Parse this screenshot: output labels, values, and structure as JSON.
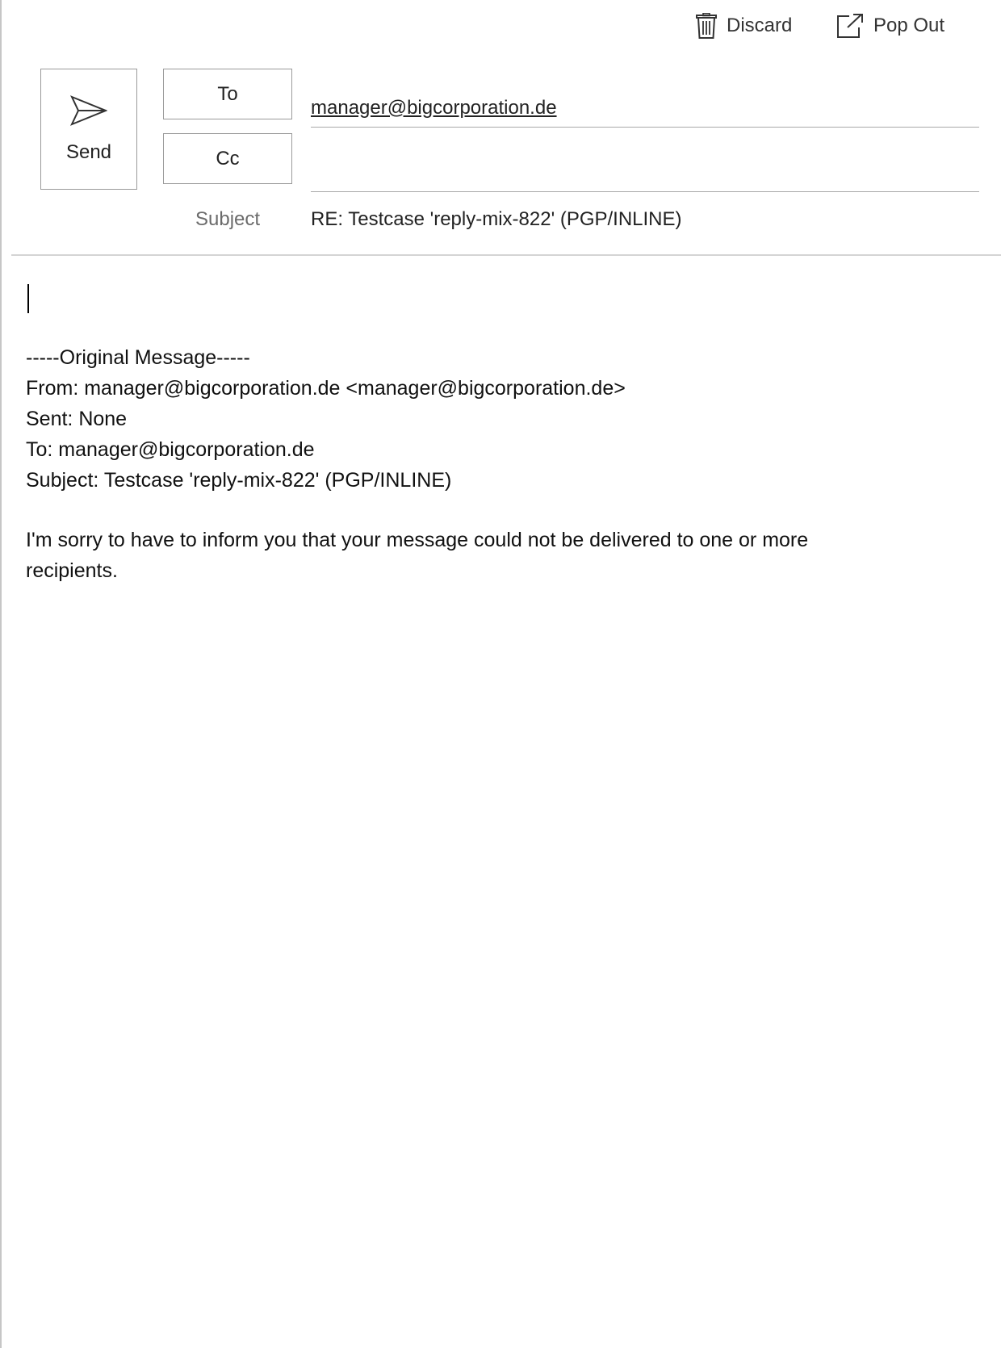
{
  "toolbar": {
    "discard_label": "Discard",
    "discard_icon": "trash-icon",
    "popout_label": "Pop Out",
    "popout_icon": "pop-out-icon"
  },
  "compose": {
    "send_label": "Send",
    "send_icon": "send-icon",
    "to_label": "To",
    "cc_label": "Cc",
    "to_recipients": [
      "manager@bigcorporation.de"
    ],
    "cc_value": "",
    "subject_label": "Subject",
    "subject_value": "RE: Testcase 'reply-mix-822' (PGP/INLINE)"
  },
  "body": {
    "header_line": "-----Original Message-----",
    "from_line": "From: manager@bigcorporation.de <manager@bigcorporation.de>",
    "sent_line": "Sent: None",
    "to_line": "To: manager@bigcorporation.de",
    "subject_line": "Subject: Testcase 'reply-mix-822' (PGP/INLINE)",
    "message_line_1": "I'm sorry to have to inform you that your message could not be delivered to one or more",
    "message_line_2": "recipients."
  },
  "colors": {
    "border": "#9a9a9a",
    "divider": "#d4d4d4",
    "label_gray": "#6b6b6b",
    "text": "#222222"
  }
}
